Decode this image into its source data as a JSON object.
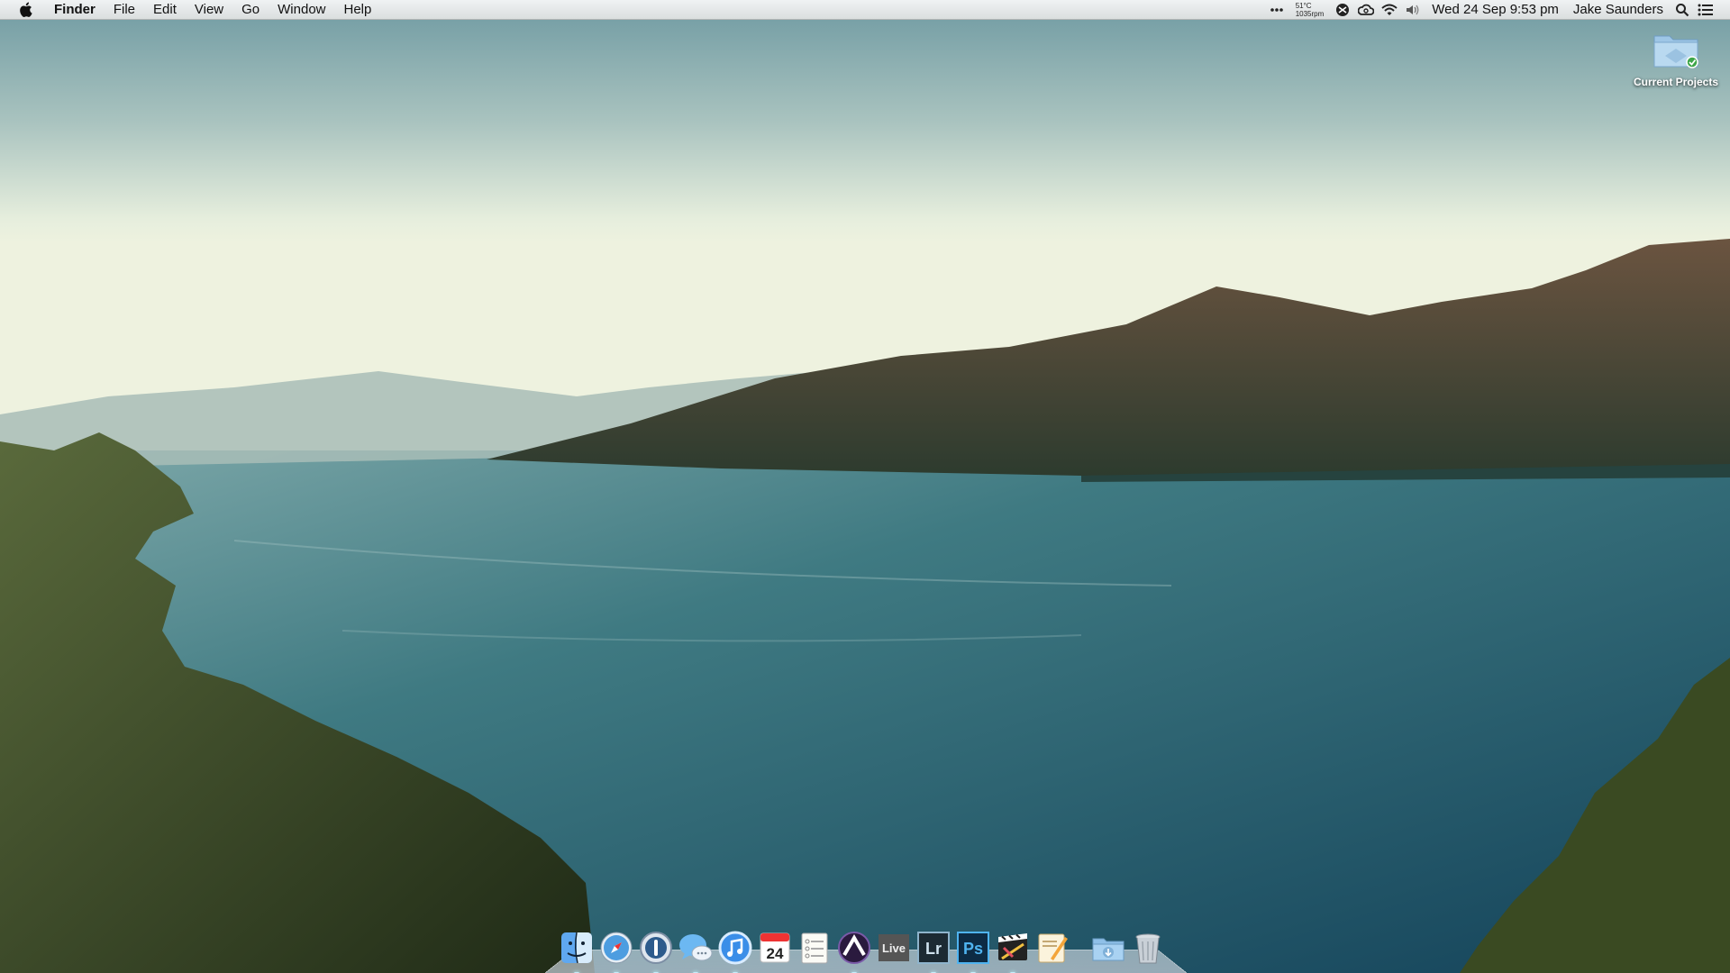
{
  "menubar": {
    "app_name": "Finder",
    "menus": [
      "File",
      "Edit",
      "View",
      "Go",
      "Window",
      "Help"
    ],
    "temperature": "51°C",
    "fan_speed": "1035rpm",
    "datetime": "Wed 24 Sep  9:53 pm",
    "user": "Jake Saunders",
    "icons": [
      "more-icon",
      "airplay-icon",
      "creative-cloud-icon",
      "wifi-icon",
      "volume-icon",
      "spotlight-icon",
      "notification-center-icon"
    ]
  },
  "desktop": {
    "icons": [
      {
        "label": "Current Projects",
        "icon": "shared-folder-icon"
      }
    ]
  },
  "dock": {
    "items": [
      {
        "name": "Finder",
        "icon": "finder-icon"
      },
      {
        "name": "Safari",
        "icon": "safari-icon"
      },
      {
        "name": "1Password",
        "icon": "onepassword-icon"
      },
      {
        "name": "Messages",
        "icon": "messages-icon"
      },
      {
        "name": "iTunes",
        "icon": "itunes-icon"
      },
      {
        "name": "Calendar",
        "icon": "calendar-icon",
        "badge": "24"
      },
      {
        "name": "Reminders",
        "icon": "reminders-icon"
      },
      {
        "name": "Pro Tools",
        "icon": "protools-icon"
      },
      {
        "name": "Ableton Live",
        "icon": "live-icon",
        "text": "Live"
      },
      {
        "name": "Lightroom",
        "icon": "lightroom-icon",
        "text": "Lr"
      },
      {
        "name": "Photoshop",
        "icon": "photoshop-icon",
        "text": "Ps"
      },
      {
        "name": "Final Cut Pro",
        "icon": "finalcut-icon"
      },
      {
        "name": "Pages",
        "icon": "pages-icon"
      },
      {
        "name": "Downloads",
        "icon": "downloads-folder-icon"
      },
      {
        "name": "Trash",
        "icon": "trash-icon"
      }
    ]
  }
}
